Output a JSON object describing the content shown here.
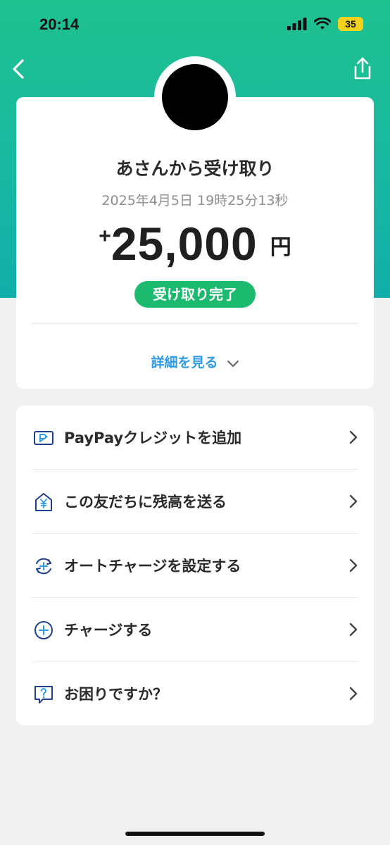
{
  "status_bar": {
    "time": "20:14",
    "battery": "35",
    "icons": [
      "cellular-signal-icon",
      "wifi-icon",
      "battery-icon"
    ]
  },
  "nav": {
    "back_icon": "chevron-left-icon",
    "share_icon": "share-icon"
  },
  "transaction": {
    "title": "あさんから受け取り",
    "datetime": "2025年4月5日 19時25分13秒",
    "amount_sign": "+",
    "amount": "25,000",
    "currency": "円",
    "status": "受け取り完了",
    "details_label": "詳細を見る"
  },
  "menu": [
    {
      "label": "PayPayクレジットを追加",
      "icon": "credit-card-icon"
    },
    {
      "label": "この友だちに残高を送る",
      "icon": "send-yen-icon"
    },
    {
      "label": "オートチャージを設定する",
      "icon": "auto-charge-icon"
    },
    {
      "label": "チャージする",
      "icon": "charge-plus-icon"
    },
    {
      "label": "お困りですか？",
      "icon": "help-question-icon"
    }
  ],
  "colors": {
    "header_gradient_top": "#1fc28f",
    "header_gradient_bottom": "#12aeaa",
    "status_green": "#1cba6e",
    "link_blue": "#2e9be8",
    "icon_navy": "#1f3f8c"
  }
}
